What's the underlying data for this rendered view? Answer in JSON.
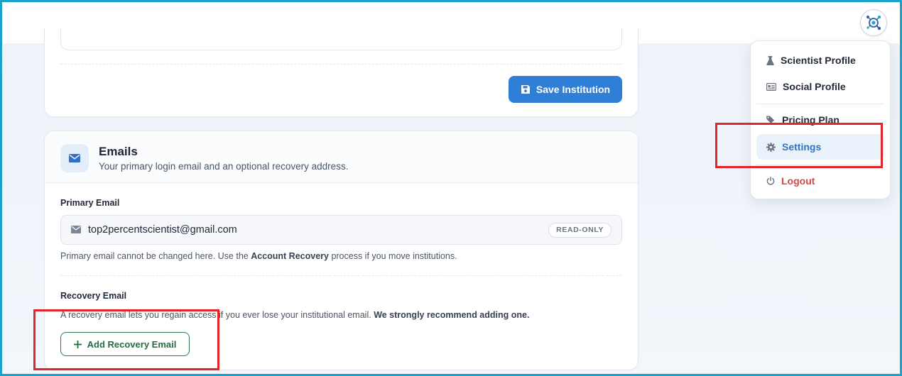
{
  "header": {
    "avatar_icon": "network-molecule-icon"
  },
  "institution_card": {
    "save_label": "Save Institution",
    "save_icon": "floppy-disk-icon"
  },
  "emails_card": {
    "title": "Emails",
    "subtitle": "Your primary login email and an optional recovery address.",
    "header_icon": "envelope-icon",
    "primary": {
      "label": "Primary Email",
      "value": "top2percentscientist@gmail.com",
      "badge": "READ-ONLY",
      "help_prefix": "Primary email cannot be changed here. Use the ",
      "help_bold": "Account Recovery",
      "help_suffix": " process if you move institutions."
    },
    "recovery": {
      "label": "Recovery Email",
      "help_prefix": "A recovery email lets you regain access if you ever lose your institutional email. ",
      "help_bold": "We strongly recommend adding one.",
      "add_label": "Add Recovery Email"
    }
  },
  "dropdown": {
    "items": [
      {
        "label": "Scientist Profile",
        "icon": "flask-icon"
      },
      {
        "label": "Social Profile",
        "icon": "id-card-icon"
      },
      {
        "label": "Pricing Plan",
        "icon": "tags-icon"
      },
      {
        "label": "Settings",
        "icon": "gear-icon",
        "active": true
      },
      {
        "label": "Logout",
        "icon": "power-icon"
      }
    ]
  },
  "colors": {
    "primary_button": "#2f7fd6",
    "add_button": "#2e7d4f",
    "active_menu": "#2f74c4",
    "logout": "#d64545",
    "annotation": "#e0262b",
    "frame": "#1aa3c9"
  }
}
